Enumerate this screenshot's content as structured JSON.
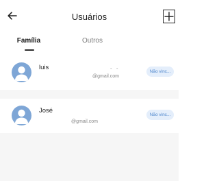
{
  "header": {
    "title": "Usuários",
    "back_icon": "arrow-left-icon",
    "add_icon": "plus-icon"
  },
  "tabs": [
    {
      "label": "Família",
      "active": true
    },
    {
      "label": "Outros",
      "active": false
    }
  ],
  "users": [
    {
      "name": "luis",
      "dash": "- -",
      "email": "@gmail.com",
      "status": "Não vinc...",
      "avatar_icon": "user-avatar-icon"
    },
    {
      "name": "José",
      "email": "@gmail.com",
      "status": "Não vinc...",
      "avatar_icon": "user-avatar-icon"
    }
  ],
  "colors": {
    "avatar": "#7ea6d6",
    "badge_bg": "#e4eefb",
    "badge_text": "#4e86cc",
    "list_bg": "#f6f6f6"
  }
}
